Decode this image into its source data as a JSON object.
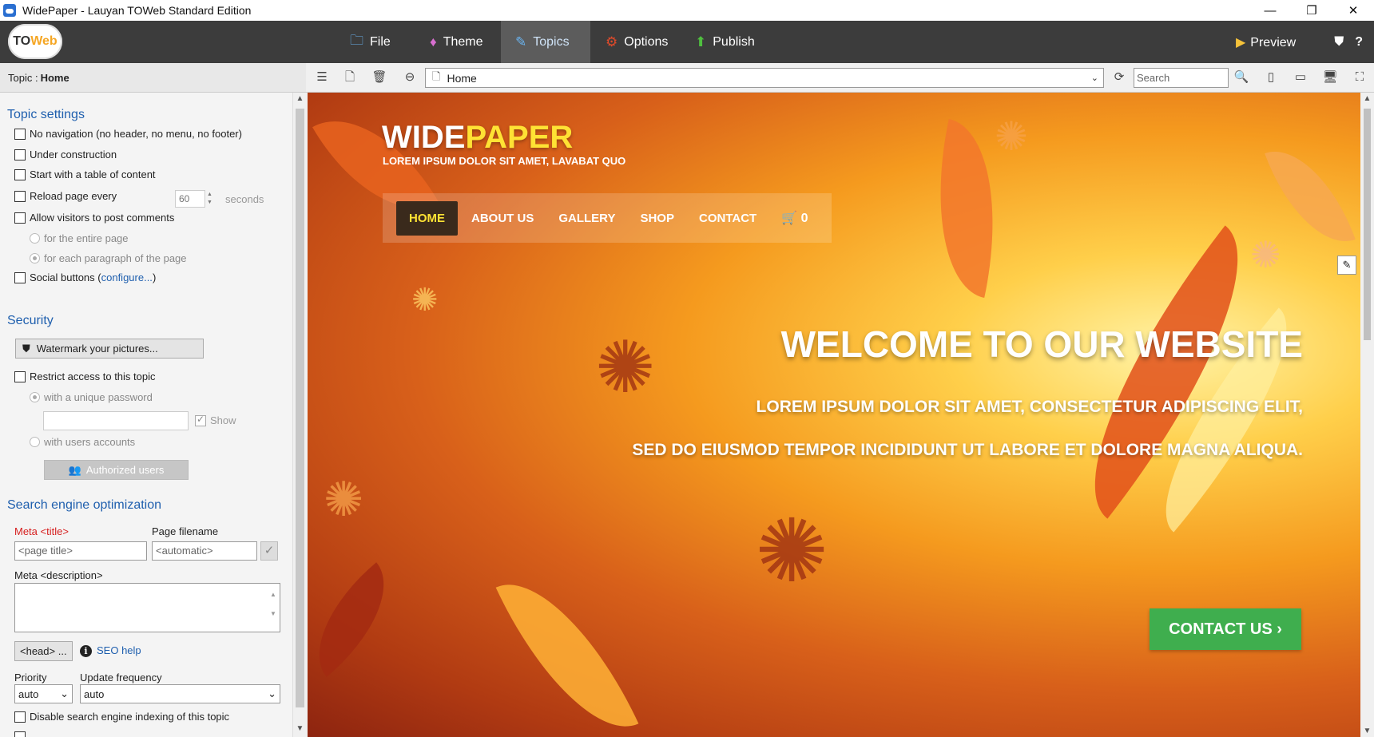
{
  "window": {
    "title": "WidePaper - Lauyan TOWeb Standard Edition",
    "controls": [
      "—",
      "❐",
      "✕"
    ]
  },
  "menu": {
    "logo_a": "TO",
    "logo_b": "Web",
    "items": [
      {
        "label": "File",
        "icon": "folder-icon"
      },
      {
        "label": "Theme",
        "icon": "paint-icon"
      },
      {
        "label": "Topics",
        "icon": "pencil-icon"
      },
      {
        "label": "Options",
        "icon": "gears-icon"
      },
      {
        "label": "Publish",
        "icon": "upload-icon"
      }
    ],
    "preview": "Preview",
    "help": "?"
  },
  "topic": {
    "prefix": "Topic :",
    "name": "Home"
  },
  "settings": {
    "title": "Topic settings",
    "no_navigation": "No navigation (no header, no menu, no footer)",
    "under_construction": "Under construction",
    "table_of_content": "Start with a table of content",
    "reload_page": "Reload page every",
    "reload_value": "60",
    "seconds": "seconds",
    "allow_comments": "Allow visitors to post comments",
    "for_entire_page": "for the entire page",
    "for_each_paragraph": "for each paragraph of the page",
    "social_buttons": "Social buttons (",
    "configure": "configure...",
    "close_paren": ")"
  },
  "security": {
    "title": "Security",
    "watermark": "Watermark your pictures...",
    "restrict": "Restrict access to this topic",
    "unique_password": "with a unique password",
    "show": "Show",
    "users_accounts": "with users accounts",
    "authorized_users": "Authorized users"
  },
  "seo": {
    "title": "Search engine optimization",
    "meta_title": "Meta <title>",
    "page_filename": "Page filename",
    "page_title_placeholder": "<page title>",
    "filename_placeholder": "<automatic>",
    "meta_description": "Meta <description>",
    "head_button": "<head> ...",
    "seo_help": "SEO help",
    "priority": "Priority",
    "update_frequency": "Update frequency",
    "priority_value": "auto",
    "frequency_value": "auto",
    "disable_indexing": "Disable search engine indexing of this topic"
  },
  "browser": {
    "address": "Home",
    "search_placeholder": "Search"
  },
  "site": {
    "brand_a": "WIDE",
    "brand_b": "PAPER",
    "tagline": "LOREM IPSUM DOLOR SIT AMET, LAVABAT QUO",
    "nav": [
      "HOME",
      "ABOUT US",
      "GALLERY",
      "SHOP",
      "CONTACT"
    ],
    "cart_count": "0",
    "hero_title": "WELCOME TO OUR WEBSITE",
    "hero_line1": "LOREM IPSUM DOLOR SIT AMET, CONSECTETUR ADIPISCING ELIT,",
    "hero_line2": "SED DO EIUSMOD TEMPOR INCIDIDUNT UT LABORE ET DOLORE MAGNA ALIQUA.",
    "cta": "CONTACT US ›"
  },
  "colors": {
    "menu_bg": "#3c3c3c",
    "section_title": "#1f5fae",
    "cta_green": "#3fae4e",
    "brand_yellow": "#ffe234"
  }
}
